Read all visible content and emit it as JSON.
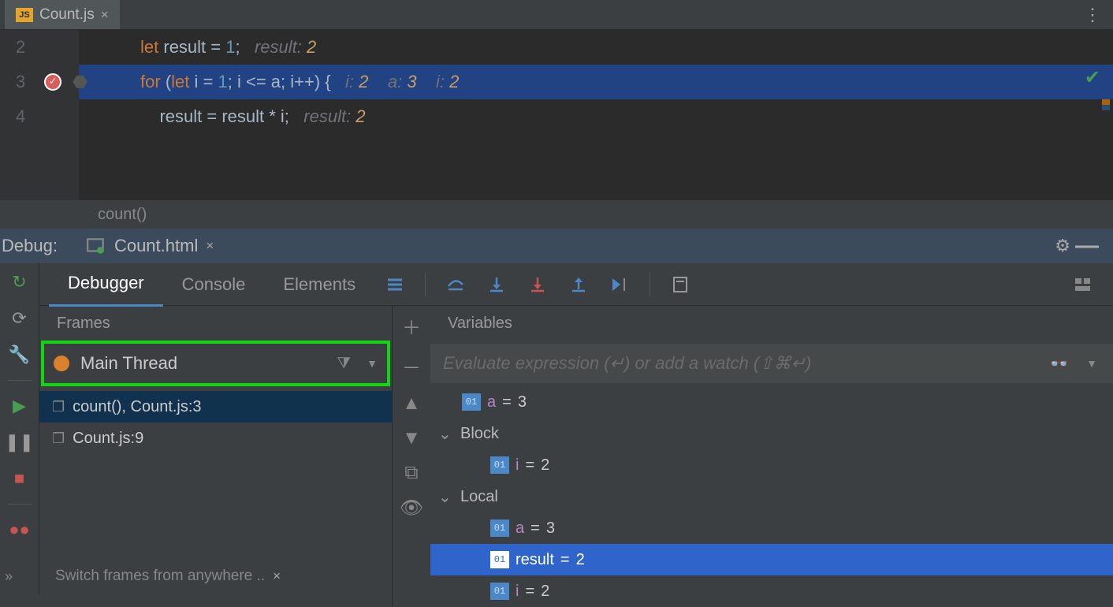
{
  "tabs": {
    "file": "Count.js"
  },
  "code": {
    "lines": [
      "2",
      "3",
      "4"
    ],
    "l2": {
      "kw": "let",
      "id": "result",
      "op": "= ",
      "num": "1",
      "semi": ";",
      "hint": "result:",
      "hv": "2"
    },
    "l3": {
      "kw": "for",
      "p1": "(",
      "kw2": "let",
      "id": "i",
      "eq": "= ",
      "num": "1",
      "c1": "; ",
      "exp": "i <= a",
      "c2": "; ",
      "inc": "i++",
      "p2": ") {",
      "h1": "i:",
      "h1v": "2",
      "h2": "a:",
      "h2v": "3",
      "h3": "i:",
      "h3v": "2"
    },
    "l4": {
      "expr": "result = result * i",
      "semi": ";",
      "hint": "result:",
      "hv": "2"
    },
    "breadcrumb": "count()"
  },
  "debug": {
    "label": "Debug:",
    "file": "Count.html"
  },
  "toolbar": {
    "tabs": [
      "Debugger",
      "Console",
      "Elements"
    ]
  },
  "frames": {
    "title": "Frames",
    "thread": "Main Thread",
    "items": [
      "count(), Count.js:3",
      "Count.js:9"
    ],
    "hint": "Switch frames from anywhere .."
  },
  "vars": {
    "title": "Variables",
    "placeholder": "Evaluate expression (↵) or add a watch (⇧⌘↵)",
    "rows": [
      {
        "badge": "01",
        "name": "a",
        "val": "3",
        "indent": 1
      },
      {
        "scope": "Block"
      },
      {
        "badge": "01",
        "name": "i",
        "val": "2",
        "indent": 2
      },
      {
        "scope": "Local"
      },
      {
        "badge": "01",
        "name": "a",
        "val": "3",
        "indent": 2
      },
      {
        "badge": "01",
        "name": "result",
        "val": "2",
        "indent": 2,
        "sel": true
      },
      {
        "badge": "01",
        "name": "i",
        "val": "2",
        "indent": 2
      }
    ]
  }
}
